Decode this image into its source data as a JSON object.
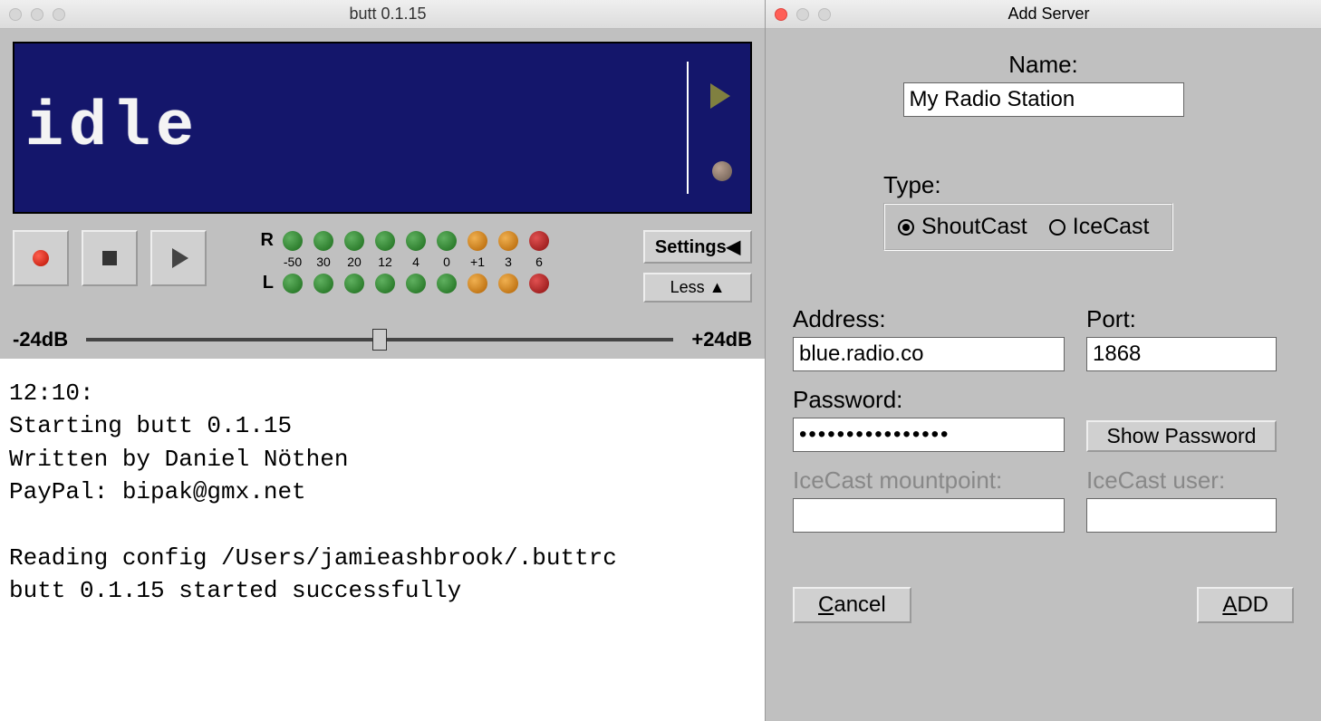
{
  "main": {
    "title": "butt 0.1.15",
    "lcd_status": "idle",
    "meter": {
      "labels": {
        "right": "R",
        "left": "L"
      },
      "scale": [
        "-50",
        "30",
        "20",
        "12",
        "4",
        "0",
        "+1",
        "3",
        "6"
      ]
    },
    "buttons": {
      "settings": "Settings◀",
      "less": "Less ▲"
    },
    "slider": {
      "min_label": "-24dB",
      "max_label": "+24dB"
    },
    "log": "12:10:\nStarting butt 0.1.15\nWritten by Daniel Nöthen\nPayPal: bipak@gmx.net\n\nReading config /Users/jamieashbrook/.buttrc\nbutt 0.1.15 started successfully"
  },
  "dialog": {
    "title": "Add Server",
    "name_label": "Name:",
    "name_value": "My Radio Station",
    "type_label": "Type:",
    "type_options": {
      "shoutcast": "ShoutCast",
      "icecast": "IceCast"
    },
    "type_selected": "shoutcast",
    "address_label": "Address:",
    "address_value": "blue.radio.co",
    "port_label": "Port:",
    "port_value": "1868",
    "password_label": "Password:",
    "password_value": "••••••••••••••••",
    "show_password": "Show Password",
    "mount_label": "IceCast mountpoint:",
    "mount_value": "",
    "user_label": "IceCast user:",
    "user_value": "",
    "cancel": "Cancel",
    "add": "ADD"
  }
}
